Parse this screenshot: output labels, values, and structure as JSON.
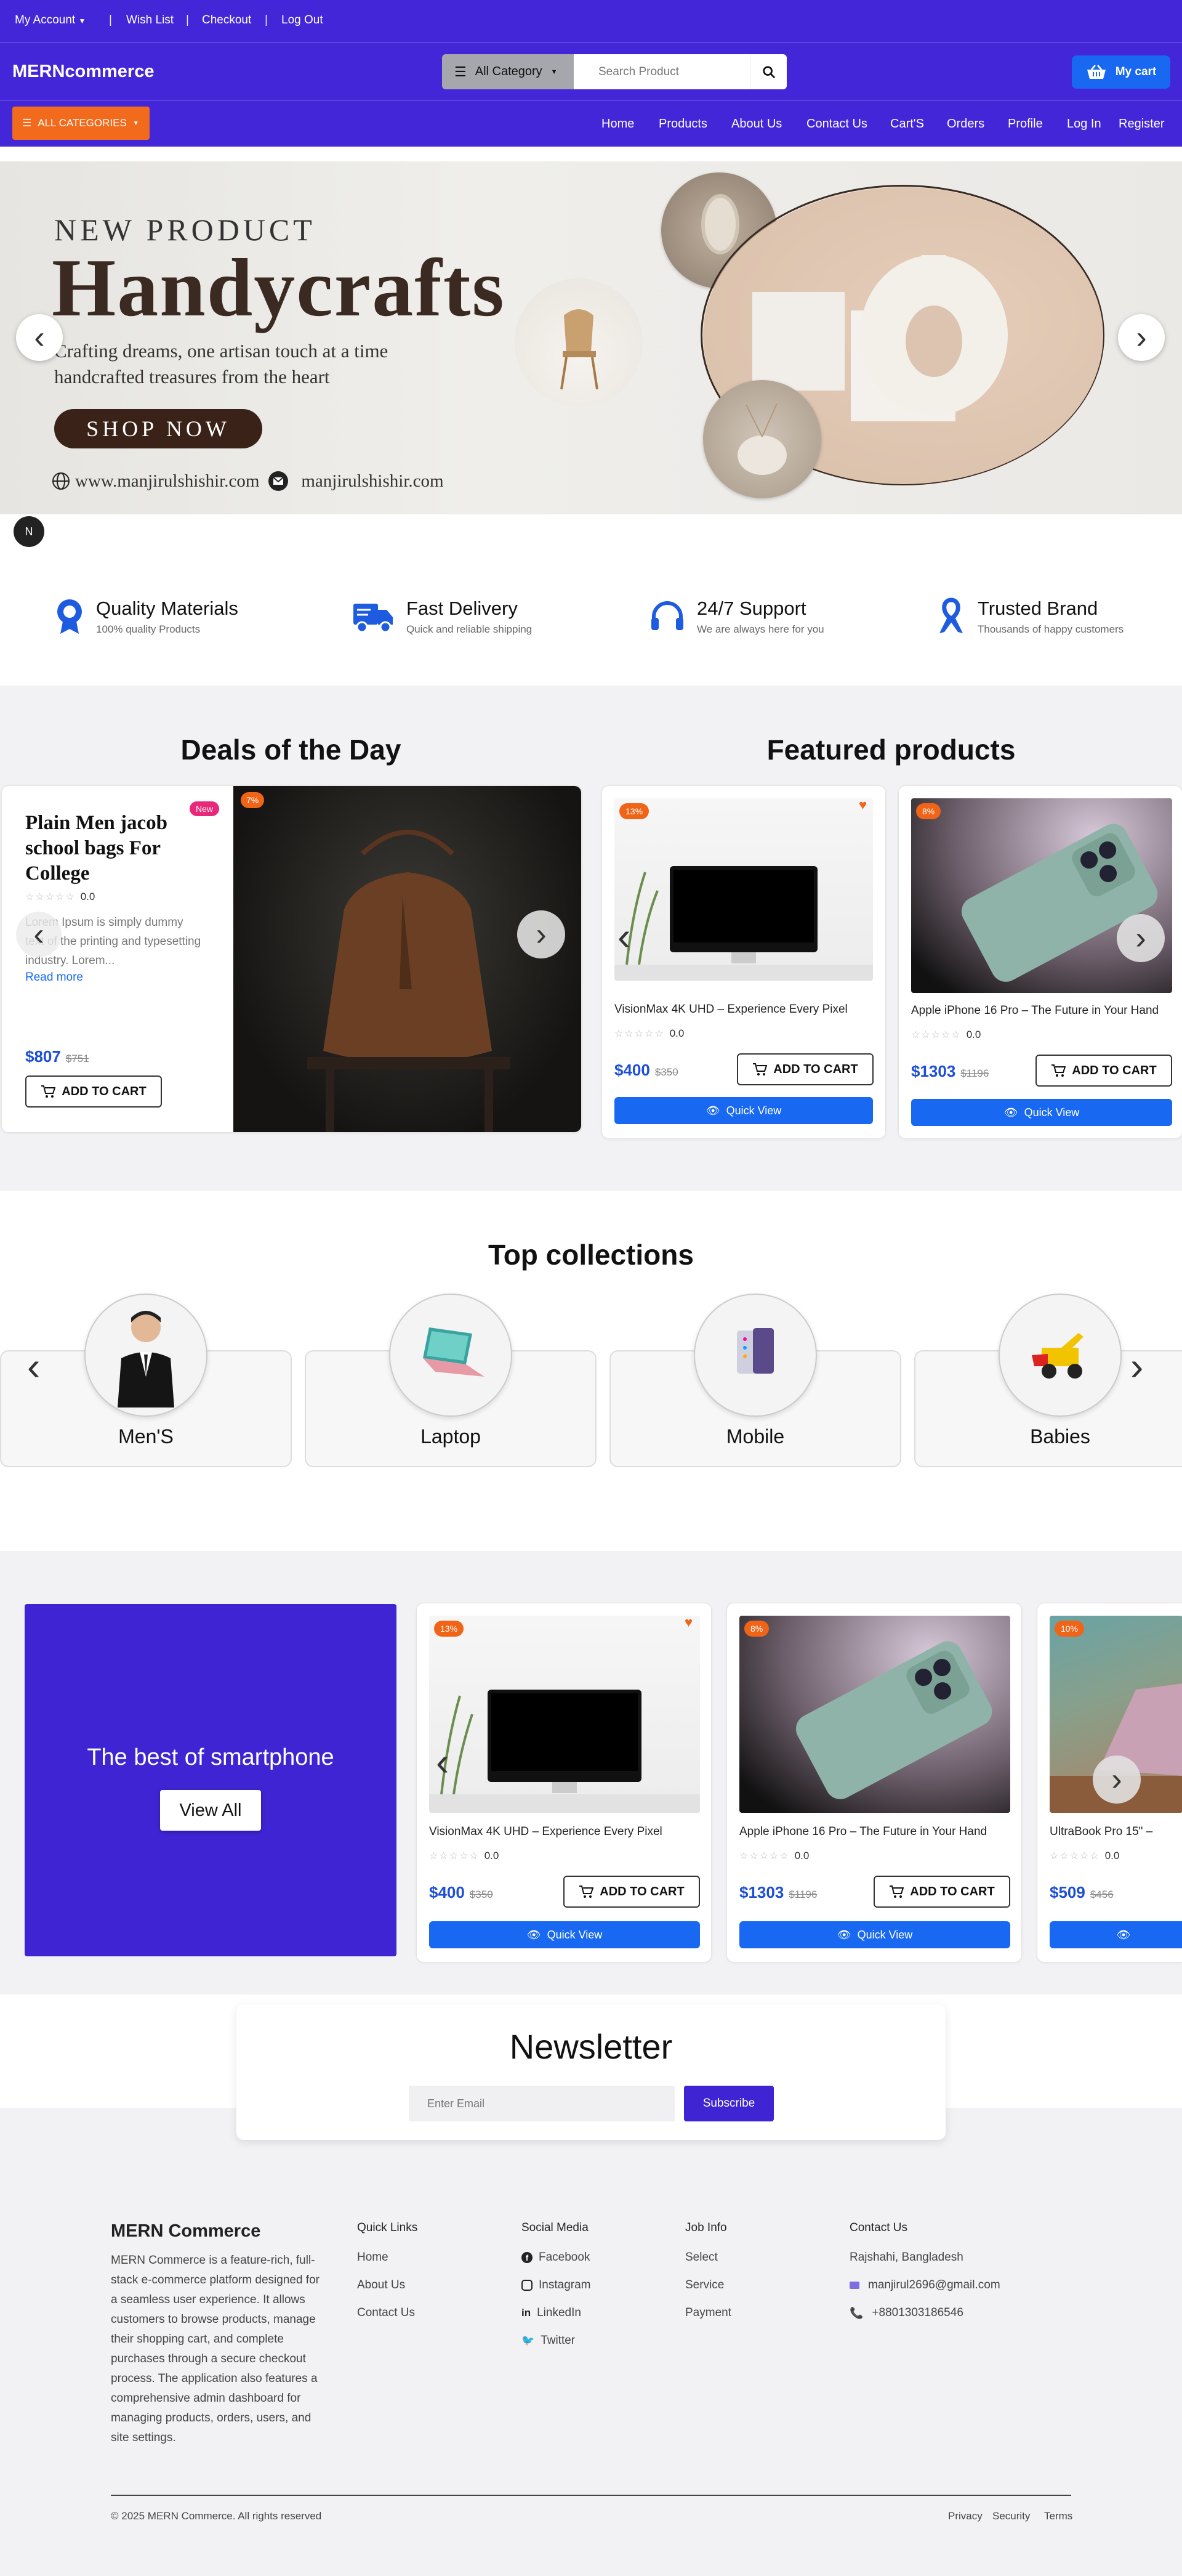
{
  "topbar": {
    "account": "My Account",
    "wishlist": "Wish List",
    "checkout": "Checkout",
    "logout": "Log Out"
  },
  "header": {
    "brand": "MERNcommerce",
    "category_select": "All Category",
    "search_placeholder": "Search Product",
    "cart_label": "My cart"
  },
  "navbar": {
    "all_categories": "ALL CATEGORIES",
    "links": [
      "Home",
      "Products",
      "About Us",
      "Contact Us",
      "Cart'S",
      "Orders",
      "Profile",
      "Log In",
      "Register"
    ]
  },
  "hero": {
    "eyebrow": "NEW PRODUCT",
    "title": "Handycrafts",
    "line1": "Crafting dreams, one artisan touch at a time",
    "line2": "handcrafted treasures from the heart",
    "cta": "SHOP NOW",
    "website": "www.manjirulshishir.com",
    "email": "manjirulshishir.com",
    "next_badge": "N"
  },
  "features": [
    {
      "title": "Quality Materials",
      "sub": "100% quality Products",
      "icon": "medal-icon"
    },
    {
      "title": "Fast Delivery",
      "sub": "Quick and reliable shipping",
      "icon": "truck-icon"
    },
    {
      "title": "24/7 Support",
      "sub": "We are always here for you",
      "icon": "headset-icon"
    },
    {
      "title": "Trusted Brand",
      "sub": "Thousands of happy customers",
      "icon": "ribbon-icon"
    }
  ],
  "deals": {
    "heading": "Deals of the Day",
    "title": "Plain Men jacob school bags For College",
    "new_badge": "New",
    "discount": "7%",
    "rating": "0.0",
    "desc": "Lorem Ipsum is simply dummy text of the printing and typesetting industry. Lorem...",
    "read_more": "Read more",
    "price": "$807",
    "old_price": "$751",
    "add_to_cart": "ADD TO CART"
  },
  "featured": {
    "heading": "Featured products",
    "products": [
      {
        "badge": "13%",
        "title": "VisionMax 4K UHD – Experience Every Pixel",
        "rating": "0.0",
        "price": "$400",
        "old_price": "$350",
        "add_to_cart": "ADD TO CART",
        "quick_view": "Quick View"
      },
      {
        "badge": "8%",
        "title": "Apple iPhone 16 Pro – The Future in Your Hand",
        "rating": "0.0",
        "price": "$1303",
        "old_price": "$1196",
        "add_to_cart": "ADD TO CART",
        "quick_view": "Quick View"
      }
    ]
  },
  "collections": {
    "heading": "Top collections",
    "items": [
      "Men'S",
      "Laptop",
      "Mobile",
      "Babies"
    ]
  },
  "smartphone": {
    "banner_text": "The best of smartphone",
    "view_all": "View All",
    "products": [
      {
        "badge": "13%",
        "title": "VisionMax 4K UHD – Experience Every Pixel",
        "rating": "0.0",
        "price": "$400",
        "old_price": "$350",
        "add_to_cart": "ADD TO CART",
        "quick_view": "Quick View"
      },
      {
        "badge": "8%",
        "title": "Apple iPhone 16 Pro – The Future in Your Hand",
        "rating": "0.0",
        "price": "$1303",
        "old_price": "$1196",
        "add_to_cart": "ADD TO CART",
        "quick_view": "Quick View"
      },
      {
        "badge": "10%",
        "title": "UltraBook Pro 15\" –",
        "rating": "0.0",
        "price": "$509",
        "old_price": "$456"
      }
    ]
  },
  "newsletter": {
    "title": "Newsletter",
    "placeholder": "Enter Email",
    "button": "Subscribe"
  },
  "footer": {
    "brand": "MERN Commerce",
    "about": "MERN Commerce is a feature-rich, full-stack e-commerce platform designed for a seamless user experience. It allows customers to browse products, manage their shopping cart, and complete purchases through a secure checkout process. The application also features a comprehensive admin dashboard for managing products, orders, users, and site settings.",
    "quick_links_title": "Quick Links",
    "quick_links": [
      "Home",
      "About Us",
      "Contact Us"
    ],
    "social_title": "Social Media",
    "social": [
      "Facebook",
      "Instagram",
      "LinkedIn",
      "Twitter"
    ],
    "job_title": "Job Info",
    "job": [
      "Select",
      "Service",
      "Payment"
    ],
    "contact_title": "Contact Us",
    "location": "Rajshahi, Bangladesh",
    "email": "manjirul2696@gmail.com",
    "phone": "+8801303186546",
    "copyright": "© 2025 MERN Commerce. All rights reserved",
    "legal": [
      "Privacy",
      "Security",
      "Terms"
    ]
  },
  "colors": {
    "primary": "#4226d8",
    "accent_orange": "#f26b1d",
    "blue_button": "#1868f2",
    "price_blue": "#1d4ed8"
  }
}
